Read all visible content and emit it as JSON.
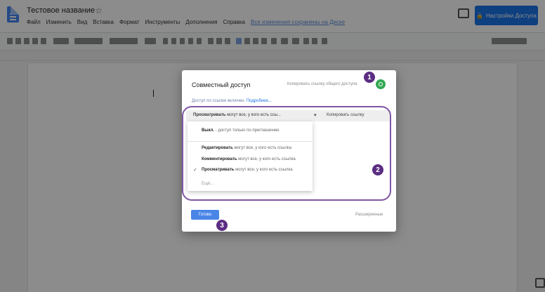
{
  "header": {
    "doc_title": "Тестовое название",
    "menu_items": [
      "Файл",
      "Изменить",
      "Вид",
      "Вставка",
      "Формат",
      "Инструменты",
      "Дополнения",
      "Справка"
    ],
    "last_edit": "Все изменения сохранены на Диске",
    "share_label": "Настройки Доступа"
  },
  "dialog": {
    "title": "Совместный доступ",
    "copy_link_hint": "Копировать ссылку общего доступа",
    "access_text": "Доступ по ссылке включен.",
    "access_more": "Подробнее...",
    "dropdown_bold": "Просматривать",
    "dropdown_rest": "могут все, у кого есть ссы...",
    "copy_link_button": "Копировать ссылку",
    "menu_items": [
      {
        "bold": "Выкл.",
        "rest": " - доступ только по приглашению"
      },
      {
        "bold": "Редактировать",
        "rest": " могут все, у кого есть ссылка"
      },
      {
        "bold": "Комментировать",
        "rest": " могут все, у кого есть ссылка"
      },
      {
        "bold": "Просматривать",
        "rest": " могут все, у кого есть ссылка"
      },
      {
        "bold": "",
        "rest": "Ещё..."
      }
    ],
    "selected_index": 3,
    "done_label": "Готово",
    "advanced_label": "Расширенные"
  },
  "annotations": {
    "badge_1": "1",
    "badge_2": "2",
    "badge_3": "3",
    "accent_color": "#5b2d82"
  }
}
